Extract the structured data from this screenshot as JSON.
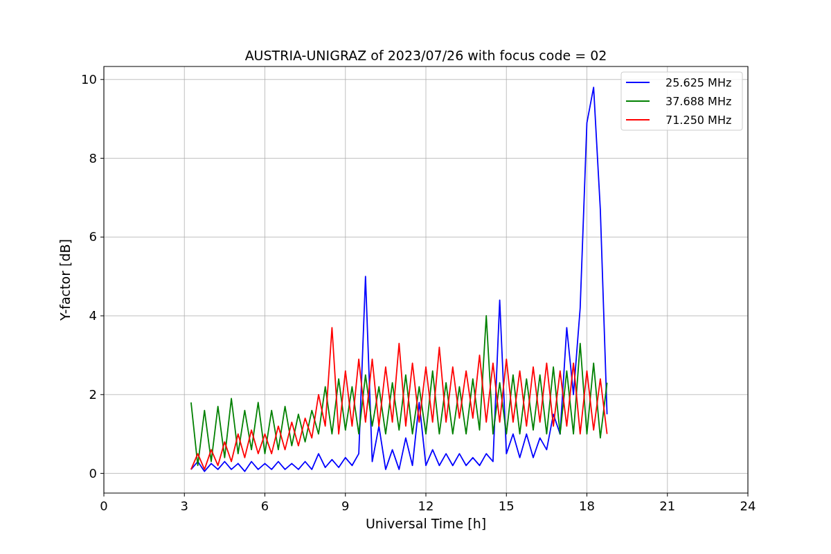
{
  "figure": {
    "chart_data": {
      "type": "line",
      "title": "AUSTRIA-UNIGRAZ of 2023/07/26 with focus code = 02",
      "xlabel": "Universal Time [h]",
      "ylabel": "Y-factor [dB]",
      "x": [
        3.25,
        3.5,
        3.75,
        4.0,
        4.25,
        4.5,
        4.75,
        5.0,
        5.25,
        5.5,
        5.75,
        6.0,
        6.25,
        6.5,
        6.75,
        7.0,
        7.25,
        7.5,
        7.75,
        8.0,
        8.25,
        8.5,
        8.75,
        9.0,
        9.25,
        9.5,
        9.75,
        10.0,
        10.25,
        10.5,
        10.75,
        11.0,
        11.25,
        11.5,
        11.75,
        12.0,
        12.25,
        12.5,
        12.75,
        13.0,
        13.25,
        13.5,
        13.75,
        14.0,
        14.25,
        14.5,
        14.75,
        15.0,
        15.25,
        15.5,
        15.75,
        16.0,
        16.25,
        16.5,
        16.75,
        17.0,
        17.25,
        17.5,
        17.75,
        18.0,
        18.25,
        18.5,
        18.75
      ],
      "series": [
        {
          "name": "25.625 MHz",
          "color": "#0000ff",
          "values": [
            0.1,
            0.3,
            0.05,
            0.25,
            0.1,
            0.3,
            0.1,
            0.25,
            0.05,
            0.3,
            0.1,
            0.25,
            0.1,
            0.3,
            0.1,
            0.25,
            0.1,
            0.3,
            0.1,
            0.5,
            0.15,
            0.35,
            0.15,
            0.4,
            0.2,
            0.5,
            5.0,
            0.3,
            1.2,
            0.1,
            0.6,
            0.1,
            0.9,
            0.2,
            1.8,
            0.2,
            0.6,
            0.2,
            0.5,
            0.2,
            0.5,
            0.2,
            0.4,
            0.2,
            0.5,
            0.3,
            4.4,
            0.5,
            1.0,
            0.4,
            1.0,
            0.4,
            0.9,
            0.6,
            1.5,
            1.0,
            3.7,
            2.0,
            4.2,
            8.9,
            9.8,
            6.7,
            1.5
          ]
        },
        {
          "name": "37.688 MHz",
          "color": "#008000",
          "values": [
            1.8,
            0.2,
            1.6,
            0.3,
            1.7,
            0.4,
            1.9,
            0.5,
            1.6,
            0.6,
            1.8,
            0.5,
            1.6,
            0.6,
            1.7,
            0.7,
            1.5,
            0.8,
            1.6,
            1.0,
            2.2,
            1.0,
            2.4,
            1.1,
            2.2,
            1.0,
            2.5,
            1.2,
            2.2,
            1.0,
            2.3,
            1.1,
            2.5,
            1.0,
            2.2,
            1.0,
            2.6,
            1.0,
            2.3,
            1.0,
            2.2,
            1.0,
            2.4,
            1.1,
            4.0,
            1.0,
            2.3,
            1.0,
            2.5,
            1.0,
            2.4,
            1.1,
            2.5,
            1.0,
            2.7,
            1.0,
            2.6,
            1.0,
            3.3,
            1.0,
            2.8,
            0.9,
            2.3
          ]
        },
        {
          "name": "71.250 MHz",
          "color": "#ff0000",
          "values": [
            0.1,
            0.5,
            0.1,
            0.6,
            0.2,
            0.8,
            0.3,
            1.0,
            0.4,
            1.1,
            0.5,
            1.0,
            0.5,
            1.2,
            0.6,
            1.3,
            0.7,
            1.4,
            0.9,
            2.0,
            1.2,
            3.7,
            1.0,
            2.6,
            1.2,
            2.9,
            1.3,
            2.9,
            1.2,
            2.7,
            1.3,
            3.3,
            1.2,
            2.8,
            1.3,
            2.7,
            1.3,
            3.2,
            1.3,
            2.7,
            1.4,
            2.6,
            1.4,
            3.0,
            1.3,
            2.8,
            1.3,
            2.9,
            1.3,
            2.6,
            1.2,
            2.7,
            1.3,
            2.8,
            1.2,
            2.6,
            1.2,
            2.8,
            1.0,
            2.6,
            1.1,
            2.4,
            1.0
          ]
        }
      ],
      "grid": true,
      "legend": true,
      "xlim": [
        0,
        24
      ],
      "ylim": [
        -0.5,
        10.33
      ],
      "xticks": [
        0,
        3,
        6,
        9,
        12,
        15,
        18,
        21,
        24
      ],
      "yticks": [
        0,
        2,
        4,
        6,
        8,
        10
      ]
    }
  }
}
